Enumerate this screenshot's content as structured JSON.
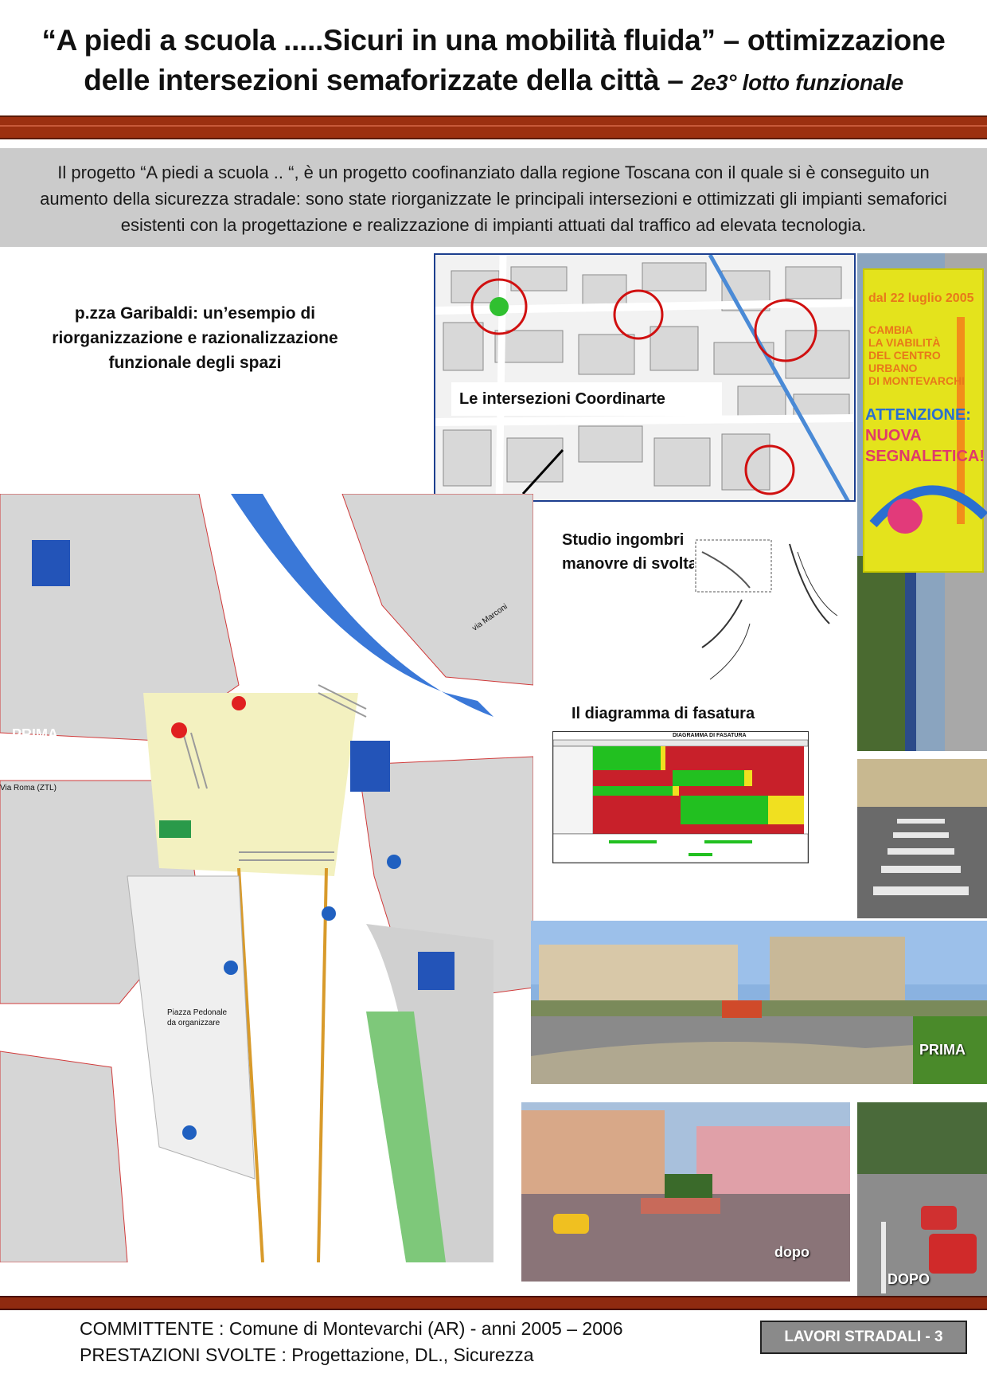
{
  "header": {
    "title_line1": "“A piedi a scuola .....Sicuri in una mobilità fluida” – ottimizzazione",
    "title_line2": "delle intersezioni semaforizzate della città –",
    "title_suffix": "2e3° lotto funzionale"
  },
  "intro": {
    "text": "Il progetto “A piedi a scuola .. “, è un progetto coofinanziato dalla regione Toscana con il quale si è conseguito un aumento della sicurezza stradale: sono state riorganizzate le principali intersezioni e ottimizzati gli impianti semaforici esistenti con la progettazione e realizzazione di impianti attuati dal traffico ad elevata tecnologia."
  },
  "captions": {
    "garibaldi": "p.zza Garibaldi: un’esempio di riorganizzazione e razionalizzazione funzionale degli spazi",
    "coordinate_map": "Le intersezioni Coordinarte",
    "ingombri_line1": "Studio ingombri",
    "ingombri_line2": "manovre di svolta",
    "fasatura": "Il diagramma di fasatura"
  },
  "plan_labels": {
    "prima": "PRIMA",
    "via_roma": "Via Roma (ZTL)",
    "via_marconi": "via Marconi",
    "piazza_pedonale": "Piazza Pedonale da organizzare"
  },
  "banner": {
    "date": "dal 22 luglio 2005",
    "line1": "CAMBIA",
    "line2": "LA VIABILITÀ",
    "line3": "DEL CENTRO URBANO",
    "line4": "DI MONTEVARCHI",
    "attention": "ATTENZIONE:",
    "line5": "NUOVA",
    "line6": "SEGNALETICA!"
  },
  "photo_tags": {
    "prima": "PRIMA",
    "dopo": "dopo",
    "dopo_upper": "DOPO"
  },
  "phase_diagram": {
    "header": "DIAGRAMMA DI FASATURA"
  },
  "footer": {
    "committente": "COMMITTENTE : Comune di Montevarchi (AR)  -  anni 2005 – 2006",
    "prestazioni": "PRESTAZIONI SVOLTE : Progettazione, DL., Sicurezza",
    "badge": "LAVORI STRADALI - 3"
  },
  "colors": {
    "brand_band": "#9c3010",
    "intro_bg": "#cbcbcb",
    "map_border": "#1d3f8f",
    "phase_red": "#c8202a",
    "phase_green": "#22c020",
    "phase_yellow": "#f0e020"
  }
}
